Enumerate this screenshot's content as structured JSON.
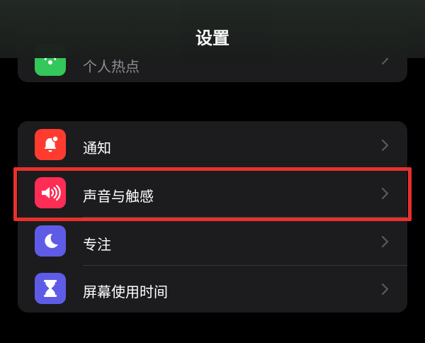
{
  "header": {
    "title": "设置"
  },
  "top_group": {
    "item": {
      "label": "个人热点",
      "icon": "hotspot-icon",
      "icon_color": "#34c759"
    }
  },
  "group": {
    "items": [
      {
        "label": "通知",
        "icon": "bell-badge-icon",
        "icon_color": "#ff3b30"
      },
      {
        "label": "声音与触感",
        "icon": "speaker-icon",
        "icon_color": "#ff2d55"
      },
      {
        "label": "专注",
        "icon": "moon-icon",
        "icon_color": "#5e5ce6"
      },
      {
        "label": "屏幕使用时间",
        "icon": "hourglass-icon",
        "icon_color": "#5e5ce6"
      }
    ]
  },
  "annotation": {
    "highlight_color": "#e8302c"
  }
}
